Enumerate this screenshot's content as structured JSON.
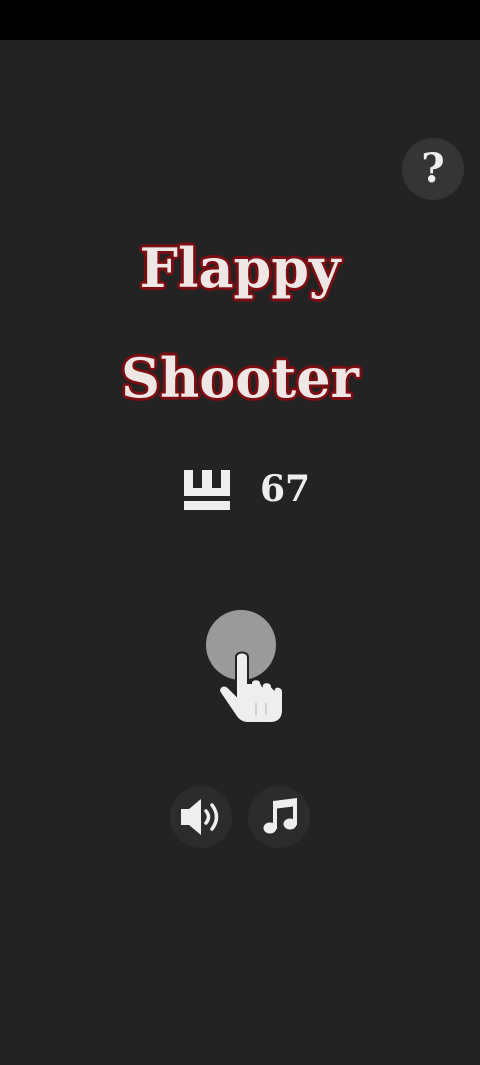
{
  "game": {
    "title_line1": "Flappy",
    "title_line2": "Shooter",
    "best_score": "67"
  },
  "buttons": {
    "help_label": "?"
  },
  "icons": {
    "best_score": "crown-icon",
    "tap_hint": "tap-hand-icon",
    "sound": "speaker-icon",
    "music": "music-note-icon"
  },
  "colors": {
    "background": "#232323",
    "title_fill": "#efe6e6",
    "title_outline": "#7a0e12",
    "icon_fill": "#eeeeee",
    "button_bg": "#353535"
  }
}
